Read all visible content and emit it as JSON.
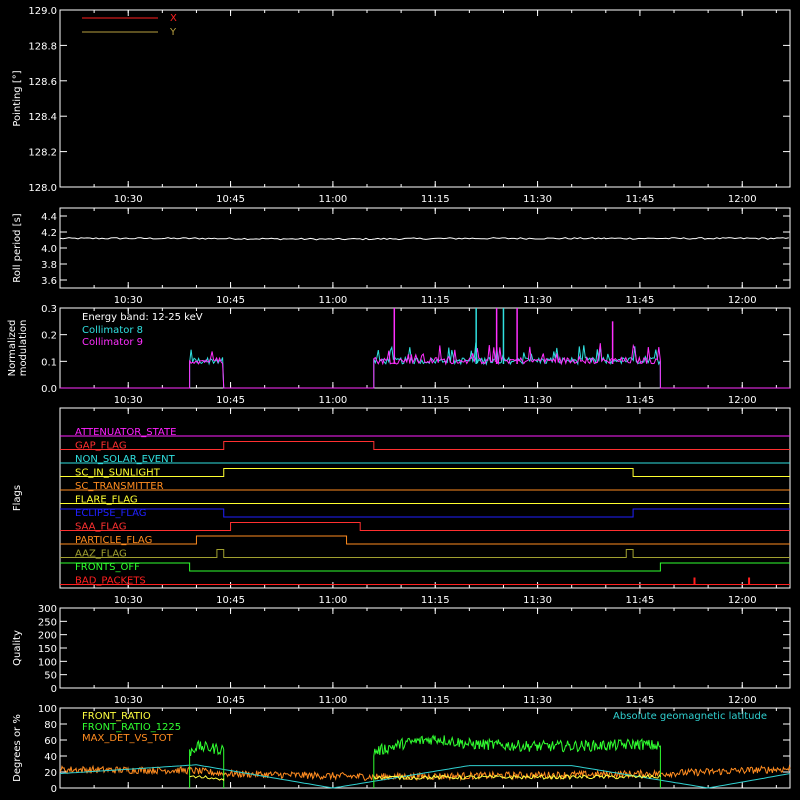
{
  "time_axis": {
    "start": "10:20",
    "end": "12:07",
    "ticks": [
      "10:30",
      "10:45",
      "11:00",
      "11:15",
      "11:30",
      "11:45",
      "12:00"
    ]
  },
  "colors": {
    "background": "#000000",
    "axes": "#ffffff",
    "x_series": "#ff2020",
    "y_series": "#b8a040",
    "roll": "#ffffff",
    "collimator_8": "#30e0e0",
    "collimator_9": "#ff30ff",
    "front_ratio": "#ffff40",
    "front_ratio_1225": "#30ff30",
    "max_det": "#ff8c20",
    "geomag": "#30d0d0"
  },
  "chart_data": [
    {
      "id": "pointing",
      "type": "line",
      "ylabel": "Pointing [°]",
      "ylim": [
        128.0,
        129.0
      ],
      "yticks": [
        "128.0",
        "128.2",
        "128.4",
        "128.6",
        "128.8",
        "129.0"
      ],
      "legend": [
        "X",
        "Y"
      ],
      "legend_position": "top-left",
      "series": [
        {
          "name": "X",
          "values": []
        },
        {
          "name": "Y",
          "values": []
        }
      ]
    },
    {
      "id": "roll",
      "type": "line",
      "ylabel": "Roll period [s]",
      "ylim": [
        3.5,
        4.5
      ],
      "yticks": [
        "3.6",
        "3.8",
        "4.0",
        "4.2",
        "4.4"
      ],
      "series": [
        {
          "x": [
            "10:20",
            "10:40",
            "11:00",
            "11:20",
            "11:40",
            "12:07"
          ],
          "values": [
            4.12,
            4.12,
            4.11,
            4.12,
            4.12,
            4.12
          ]
        }
      ]
    },
    {
      "id": "modulation",
      "type": "line",
      "ylabel": [
        "Normalized",
        "modulation"
      ],
      "ylim": [
        0,
        0.3
      ],
      "yticks": [
        "0.0",
        "0.1",
        "0.2",
        "0.3"
      ],
      "annotation": "Energy band: 12-25 keV",
      "legend": [
        "Collimator 8",
        "Collimator 9"
      ],
      "legend_position": "top-left",
      "active_intervals": [
        [
          "10:39",
          "10:44"
        ],
        [
          "11:06",
          "11:48"
        ]
      ],
      "baseline": 0.09,
      "spikes": [
        {
          "t": "11:09",
          "v": 0.31,
          "series": "Collimator 9"
        },
        {
          "t": "11:21",
          "v": 0.31,
          "series": "Collimator 8"
        },
        {
          "t": "11:24",
          "v": 0.31,
          "series": "Collimator 9"
        },
        {
          "t": "11:25",
          "v": 0.31,
          "series": "Collimator 8"
        },
        {
          "t": "11:27",
          "v": 0.3,
          "series": "Collimator 9"
        },
        {
          "t": "11:41",
          "v": 0.25,
          "series": "Collimator 9"
        }
      ]
    },
    {
      "id": "flags",
      "type": "step",
      "ylabel": "Flags",
      "flags": [
        {
          "name": "ATTENUATOR_STATE",
          "color": "#ff20ff",
          "transitions": []
        },
        {
          "name": "GAP_FLAG",
          "color": "#ff3030",
          "transitions": [
            [
              "10:44",
              1
            ],
            [
              "11:06",
              0
            ]
          ]
        },
        {
          "name": "NON_SOLAR_EVENT",
          "color": "#30e0e0",
          "transitions": []
        },
        {
          "name": "SC_IN_SUNLIGHT",
          "color": "#ffff30",
          "transitions": [
            [
              "10:44",
              1
            ],
            [
              "11:44",
              0
            ]
          ]
        },
        {
          "name": "SC_TRANSMITTER",
          "color": "#ff8c20",
          "transitions": []
        },
        {
          "name": "FLARE_FLAG",
          "color": "#ffff30",
          "transitions": []
        },
        {
          "name": "ECLIPSE_FLAG",
          "color": "#2020ff",
          "transitions": [
            [
              "10:44",
              0
            ],
            [
              "11:44",
              1
            ]
          ]
        },
        {
          "name": "SAA_FLAG",
          "color": "#ff3030",
          "transitions": [
            [
              "10:45",
              1
            ],
            [
              "11:04",
              0
            ]
          ]
        },
        {
          "name": "PARTICLE_FLAG",
          "color": "#ff8c20",
          "transitions": [
            [
              "10:40",
              1
            ],
            [
              "11:02",
              0
            ]
          ]
        },
        {
          "name": "AAZ_FLAG",
          "color": "#a0a030",
          "transitions": [
            [
              "10:43",
              1
            ],
            [
              "10:44",
              0
            ],
            [
              "11:43",
              1
            ],
            [
              "11:44",
              0
            ]
          ]
        },
        {
          "name": "FRONTS_OFF",
          "color": "#30ff30",
          "transitions": [
            [
              "10:39",
              0
            ],
            [
              "11:48",
              1
            ]
          ]
        },
        {
          "name": "BAD_PACKETS",
          "color": "#ff2020",
          "transitions": [],
          "marks": [
            "11:53",
            "12:01"
          ]
        }
      ]
    },
    {
      "id": "quality",
      "type": "line",
      "ylabel": "Quality",
      "ylim": [
        0,
        300
      ],
      "yticks": [
        "0",
        "50",
        "100",
        "150",
        "200",
        "250",
        "300"
      ],
      "series": []
    },
    {
      "id": "ratios",
      "type": "line",
      "ylabel": "Degrees or %",
      "ylim": [
        0,
        100
      ],
      "yticks": [
        "0",
        "20",
        "40",
        "60",
        "80",
        "100"
      ],
      "legend": [
        "FRONT_RATIO",
        "FRONT_RATIO_1225",
        "MAX_DET_VS_TOT"
      ],
      "legend_position": "top-left",
      "annotation_right": "Absolute geomagnetic latitude",
      "series": [
        {
          "name": "FRONT_RATIO_1225",
          "segments": [
            {
              "x": [
                "10:39",
                "10:40",
                "10:42",
                "10:44"
              ],
              "values": [
                45,
                52,
                50,
                48
              ]
            },
            {
              "x": [
                "11:06",
                "11:10",
                "11:15",
                "11:20",
                "11:30",
                "11:40",
                "11:45",
                "11:48"
              ],
              "values": [
                45,
                55,
                62,
                55,
                52,
                53,
                55,
                52
              ]
            }
          ]
        },
        {
          "name": "FRONT_RATIO",
          "segments": [
            {
              "x": [
                "10:39",
                "10:44"
              ],
              "values": [
                14,
                12
              ]
            },
            {
              "x": [
                "11:06",
                "11:48"
              ],
              "values": [
                13,
                14
              ]
            }
          ]
        },
        {
          "name": "MAX_DET_VS_TOT",
          "x": [
            "10:20",
            "10:39",
            "10:44",
            "11:06",
            "11:30",
            "11:48",
            "12:07"
          ],
          "values": [
            23,
            22,
            18,
            14,
            16,
            18,
            24
          ]
        },
        {
          "name": "Absolute geomagnetic latitude",
          "x": [
            "10:20",
            "10:40",
            "11:00",
            "11:20",
            "11:35",
            "11:55",
            "12:07"
          ],
          "values": [
            18,
            29,
            0,
            28,
            28,
            0,
            18
          ]
        }
      ]
    }
  ]
}
